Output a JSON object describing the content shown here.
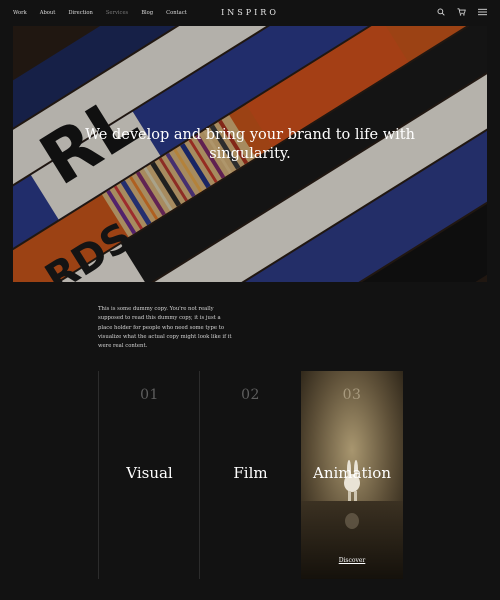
{
  "nav": {
    "links": [
      {
        "label": "Work",
        "active": false
      },
      {
        "label": "About",
        "active": false
      },
      {
        "label": "Direction",
        "active": false
      },
      {
        "label": "Services",
        "active": true
      },
      {
        "label": "Blog",
        "active": false
      },
      {
        "label": "Contact",
        "active": false
      }
    ],
    "logo": "INSPIRO",
    "icons": [
      "search-icon",
      "cart-icon",
      "menu-icon"
    ]
  },
  "hero": {
    "headline": "We develop and bring your brand to life with singularity."
  },
  "intro": {
    "text": "This is some dummy copy. You're not really supposed to read this dummy copy, it is just a place holder for people who need some type to visualize what the actual copy might look like if it were real content."
  },
  "services": [
    {
      "number": "01",
      "title": "Visual"
    },
    {
      "number": "02",
      "title": "Film"
    },
    {
      "number": "03",
      "title": "Animation",
      "link": "Discover"
    }
  ],
  "colors": {
    "background": "#121212",
    "text": "#ffffff",
    "muted": "#5e5e5e"
  }
}
